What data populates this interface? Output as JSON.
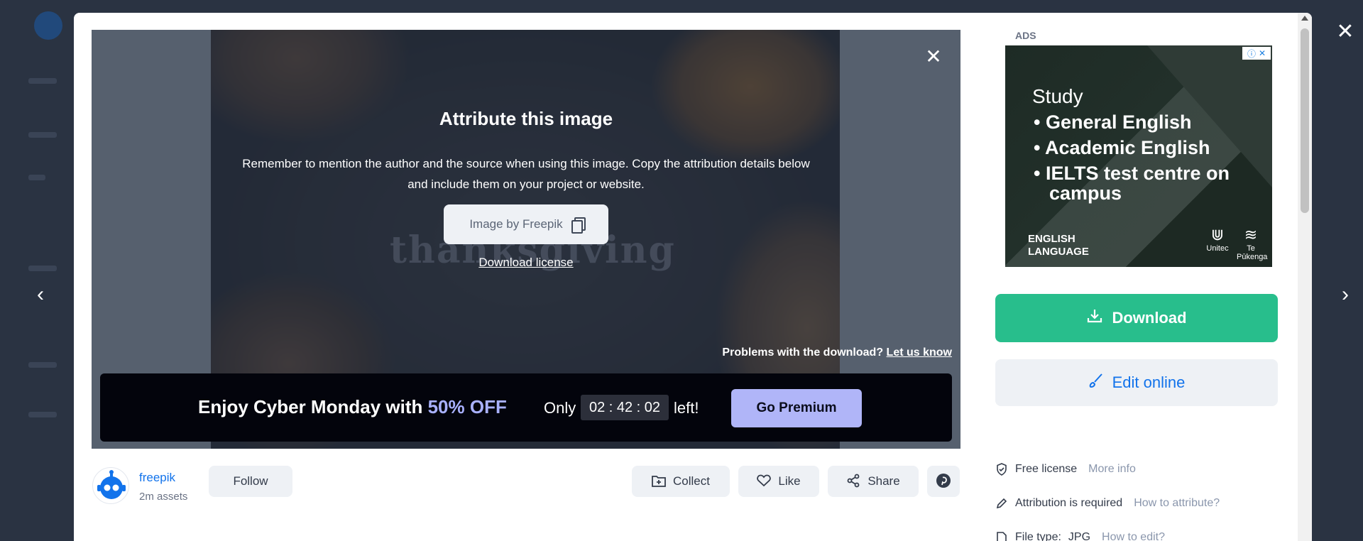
{
  "overlay": {
    "close_icon": "close-icon",
    "prev_icon": "chevron-left-icon",
    "next_icon": "chevron-right-icon"
  },
  "attribution": {
    "title": "Attribute this image",
    "description": "Remember to mention the author and the source when using this image. Copy the attribution details below and include them on your project or website.",
    "copy_text": "Image by Freepik",
    "license_link": "Download license",
    "problem_text": "Problems with the download?",
    "problem_link": "Let us know"
  },
  "promo": {
    "text_prefix": "Enjoy Cyber Monday with ",
    "text_highlight": "50% OFF",
    "only": "Only",
    "timer": "02 : 42 : 02",
    "left": "left!",
    "button": "Go Premium"
  },
  "author": {
    "name": "freepik",
    "assets": "2m assets",
    "follow": "Follow"
  },
  "actions": {
    "collect": "Collect",
    "like": "Like",
    "share": "Share"
  },
  "ads": {
    "label": "ADS",
    "study": "Study",
    "bullets": [
      "General English",
      "Academic English",
      "IELTS test centre on",
      "campus"
    ],
    "lang_line1": "ENGLISH",
    "lang_line2": "LANGUAGE",
    "logo1": "Unitec",
    "logo2": "Te Pūkenga"
  },
  "panel": {
    "download": "Download",
    "edit": "Edit online",
    "license": "Free license",
    "license_link": "More info",
    "attribution": "Attribution is required",
    "attribution_link": "How to attribute?",
    "filetype": "File type:",
    "filetype_value": "JPG",
    "filetype_link": "How to edit?"
  },
  "colors": {
    "download": "#28be8c",
    "accent_link": "#1273eb",
    "promo_button": "#b0b5f8"
  }
}
